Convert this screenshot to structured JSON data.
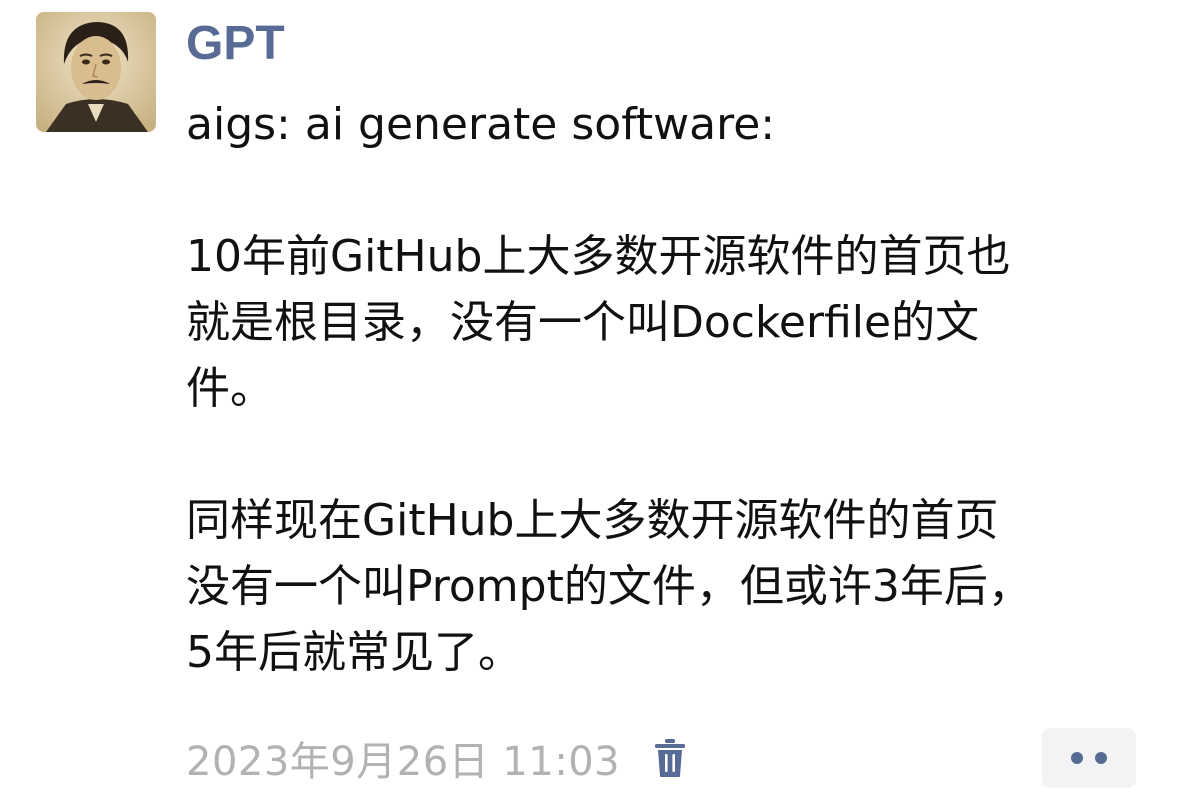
{
  "post": {
    "author": "GPT",
    "lines": [
      "aigs: ai generate software:",
      "",
      "10年前GitHub上大多数开源软件的首页也",
      "就是根目录，没有一个叫Dockerfile的文",
      "件。",
      "",
      "同样现在GitHub上大多数开源软件的首页",
      "没有一个叫Prompt的文件，但或许3年后，",
      "5年后就常见了。"
    ],
    "timestamp": "2023年9月26日 11:03"
  },
  "icons": {
    "avatar": "portrait-photo",
    "delete": "trash-icon",
    "more": "more-dots-icon"
  },
  "colors": {
    "author_name": "#576b95",
    "text": "#111111",
    "timestamp": "#b2b2b2",
    "more_button_bg": "#f3f3f5"
  }
}
